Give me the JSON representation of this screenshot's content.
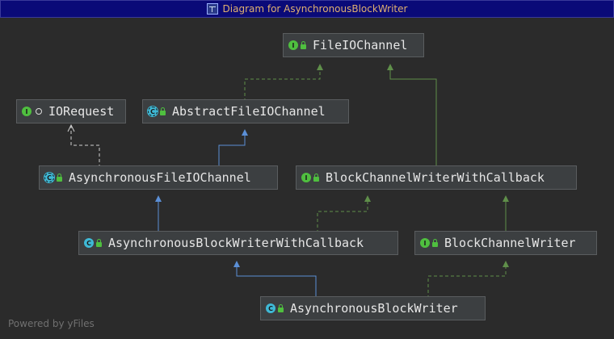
{
  "window": {
    "title": "Diagram for AsynchronousBlockWriter"
  },
  "nodes": {
    "fileiochannel": {
      "name": "FileIOChannel",
      "kind": "interface",
      "icon": "interface-icon"
    },
    "iorequest": {
      "name": "IORequest",
      "kind": "interface",
      "icon": "interface-icon"
    },
    "abstractfileiochannel": {
      "name": "AbstractFileIOChannel",
      "kind": "abstract-class",
      "icon": "abstract-class-icon"
    },
    "asynchronousfileiochannel": {
      "name": "AsynchronousFileIOChannel",
      "kind": "abstract-class",
      "icon": "abstract-class-icon"
    },
    "blockchannelwriterwithcallback": {
      "name": "BlockChannelWriterWithCallback",
      "kind": "interface",
      "icon": "interface-icon"
    },
    "asynchronousblockwriterwithcallback": {
      "name": "AsynchronousBlockWriterWithCallback",
      "kind": "class",
      "icon": "class-icon"
    },
    "blockchannelwriter": {
      "name": "BlockChannelWriter",
      "kind": "interface",
      "icon": "interface-icon"
    },
    "asynchronousblockwriter": {
      "name": "AsynchronousBlockWriter",
      "kind": "class",
      "icon": "class-icon"
    }
  },
  "badges": {
    "interface": "I",
    "class": "C"
  },
  "colors": {
    "extends_edge": "#5b8fd6",
    "implements_edge": "#5f8f4a",
    "interface_extends_edge": "#5f8f4a",
    "node_fill": "#3c3f41",
    "background": "#2b2b2b",
    "titlebar": "#0a0a78"
  },
  "footer": "Powered by yFiles"
}
